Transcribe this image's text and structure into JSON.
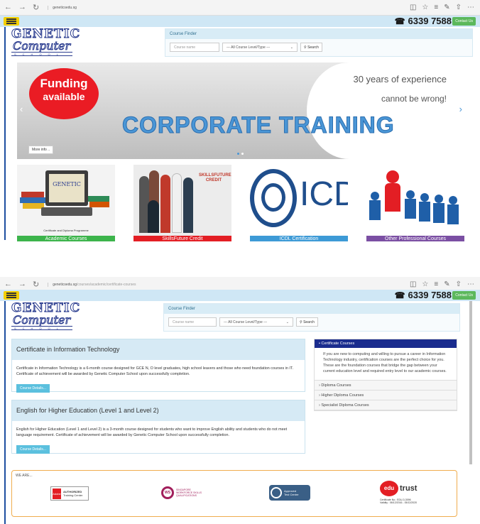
{
  "browser1": {
    "url": "geneticsedu.sg",
    "path": ""
  },
  "browser2": {
    "url": "geneticsedu.sg",
    "path": "/courses/academic/certificate-courses"
  },
  "header": {
    "phone": "6339 7588",
    "contact_label": "Contact Us"
  },
  "logo": {
    "line1": "GENETIC",
    "line2": "Computer",
    "line3": "SCHOOL"
  },
  "finder": {
    "title": "Course Finder",
    "name_placeholder": "Course name",
    "level_value": "--- All Course Level/Type ---",
    "search_label": "Search"
  },
  "hero": {
    "funding_line1": "Funding",
    "funding_line2": "available",
    "tagline1": "30 years of experience",
    "tagline2": "cannot be wrong!",
    "headline": "CORPORATE TRAINING",
    "more_label": "More info .."
  },
  "cards": [
    {
      "label": "Academic Courses",
      "color": "#3cb44b",
      "caption": "Certificate and Diploma Programme"
    },
    {
      "label": "SkillsFuture Credit",
      "color": "#e31e24",
      "caption": "SKILLSFUTURE CREDIT"
    },
    {
      "label": "ICDL Certification",
      "color": "#3d9ad6",
      "caption": "ICDL"
    },
    {
      "label": "Other Professional Courses",
      "color": "#7b4fa3",
      "caption": ""
    }
  ],
  "courses": [
    {
      "title": "Certificate in Information Technology",
      "body": "Certificate in Information Technology is a 6-month course designed for GCE N, O level graduates, high school leavers and those who need foundation courses in IT. Certificate of achievement will be awarded by Genetic Computer School upon successfully completion.",
      "button": "Course Details..."
    },
    {
      "title": "English for Higher Education (Level 1 and Level 2)",
      "body": "English for Higher Education (Level 1 and Level 2) is a 3-month course designed for students who want to improve English ability and students who do not meet language requirement. Certificate of achievement will be awarded by Genetic Computer School upon successfully completion.",
      "button": "Course Details..."
    }
  ],
  "accordion": {
    "active_title": "Certificate Courses",
    "active_body": "If you are new to computing and willing to pursue a career in Information Technology industry, certification courses are the perfect choice for you. These are the foundation courses that bridge the gap between your current education level and required entry level to our academic courses.",
    "items": [
      "Diploma Courses",
      "Higher Diploma Courses",
      "Specialist Diploma Courses"
    ]
  },
  "we_are": {
    "title": "WE ARE...",
    "adobe_line1": "AUTHORIZED",
    "adobe_line2": "Training Center",
    "adobe_mark": "Adobe",
    "wsq_line1": "SINGAPORE",
    "wsq_line2": "WORKFORCE SKILLS",
    "wsq_line3": "QUALIFICATIONS",
    "approved_line1": "Approved",
    "approved_line2": "Test Centre",
    "edutrust": "edutrust",
    "cert_no": "Certificate No.: EDU-3-3096",
    "validity": "Validity : 06/12/2016 - 05/12/2020"
  }
}
